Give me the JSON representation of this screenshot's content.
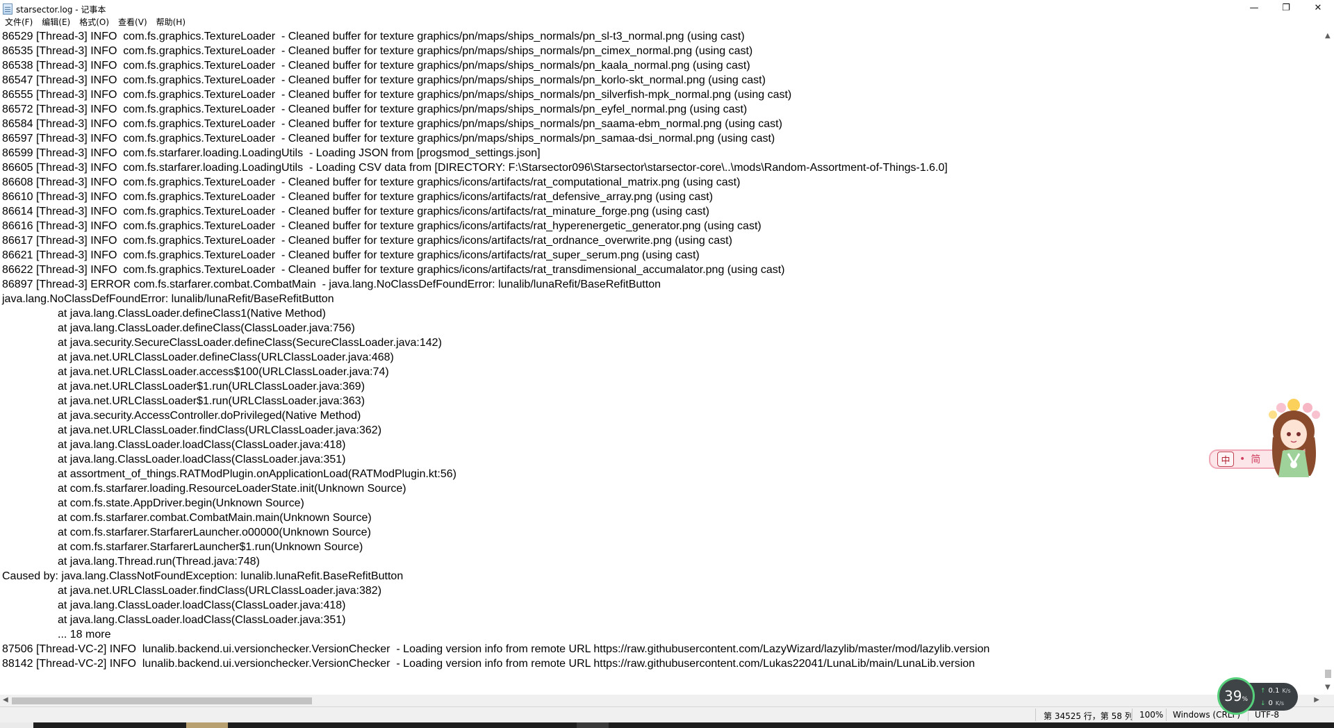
{
  "window": {
    "title": "starsector.log - 记事本",
    "minimize_glyph": "—",
    "maximize_glyph": "❐",
    "close_glyph": "✕",
    "icon": "notepad-icon"
  },
  "menu": [
    "文件(F)",
    "编辑(E)",
    "格式(O)",
    "查看(V)",
    "帮助(H)"
  ],
  "log_lines": [
    {
      "indent": false,
      "text": "86529 [Thread-3] INFO  com.fs.graphics.TextureLoader  - Cleaned buffer for texture graphics/pn/maps/ships_normals/pn_sl-t3_normal.png (using cast)"
    },
    {
      "indent": false,
      "text": "86535 [Thread-3] INFO  com.fs.graphics.TextureLoader  - Cleaned buffer for texture graphics/pn/maps/ships_normals/pn_cimex_normal.png (using cast)"
    },
    {
      "indent": false,
      "text": "86538 [Thread-3] INFO  com.fs.graphics.TextureLoader  - Cleaned buffer for texture graphics/pn/maps/ships_normals/pn_kaala_normal.png (using cast)"
    },
    {
      "indent": false,
      "text": "86547 [Thread-3] INFO  com.fs.graphics.TextureLoader  - Cleaned buffer for texture graphics/pn/maps/ships_normals/pn_korlo-skt_normal.png (using cast)"
    },
    {
      "indent": false,
      "text": "86555 [Thread-3] INFO  com.fs.graphics.TextureLoader  - Cleaned buffer for texture graphics/pn/maps/ships_normals/pn_silverfish-mpk_normal.png (using cast)"
    },
    {
      "indent": false,
      "text": "86572 [Thread-3] INFO  com.fs.graphics.TextureLoader  - Cleaned buffer for texture graphics/pn/maps/ships_normals/pn_eyfel_normal.png (using cast)"
    },
    {
      "indent": false,
      "text": "86584 [Thread-3] INFO  com.fs.graphics.TextureLoader  - Cleaned buffer for texture graphics/pn/maps/ships_normals/pn_saama-ebm_normal.png (using cast)"
    },
    {
      "indent": false,
      "text": "86597 [Thread-3] INFO  com.fs.graphics.TextureLoader  - Cleaned buffer for texture graphics/pn/maps/ships_normals/pn_samaa-dsi_normal.png (using cast)"
    },
    {
      "indent": false,
      "text": "86599 [Thread-3] INFO  com.fs.starfarer.loading.LoadingUtils  - Loading JSON from [progsmod_settings.json]"
    },
    {
      "indent": false,
      "text": "86605 [Thread-3] INFO  com.fs.starfarer.loading.LoadingUtils  - Loading CSV data from [DIRECTORY: F:\\Starsector096\\Starsector\\starsector-core\\..\\mods\\Random-Assortment-of-Things-1.6.0]"
    },
    {
      "indent": false,
      "text": "86608 [Thread-3] INFO  com.fs.graphics.TextureLoader  - Cleaned buffer for texture graphics/icons/artifacts/rat_computational_matrix.png (using cast)"
    },
    {
      "indent": false,
      "text": "86610 [Thread-3] INFO  com.fs.graphics.TextureLoader  - Cleaned buffer for texture graphics/icons/artifacts/rat_defensive_array.png (using cast)"
    },
    {
      "indent": false,
      "text": "86614 [Thread-3] INFO  com.fs.graphics.TextureLoader  - Cleaned buffer for texture graphics/icons/artifacts/rat_minature_forge.png (using cast)"
    },
    {
      "indent": false,
      "text": "86616 [Thread-3] INFO  com.fs.graphics.TextureLoader  - Cleaned buffer for texture graphics/icons/artifacts/rat_hyperenergetic_generator.png (using cast)"
    },
    {
      "indent": false,
      "text": "86617 [Thread-3] INFO  com.fs.graphics.TextureLoader  - Cleaned buffer for texture graphics/icons/artifacts/rat_ordnance_overwrite.png (using cast)"
    },
    {
      "indent": false,
      "text": "86621 [Thread-3] INFO  com.fs.graphics.TextureLoader  - Cleaned buffer for texture graphics/icons/artifacts/rat_super_serum.png (using cast)"
    },
    {
      "indent": false,
      "text": "86622 [Thread-3] INFO  com.fs.graphics.TextureLoader  - Cleaned buffer for texture graphics/icons/artifacts/rat_transdimensional_accumalator.png (using cast)"
    },
    {
      "indent": false,
      "text": "86897 [Thread-3] ERROR com.fs.starfarer.combat.CombatMain  - java.lang.NoClassDefFoundError: lunalib/lunaRefit/BaseRefitButton"
    },
    {
      "indent": false,
      "text": "java.lang.NoClassDefFoundError: lunalib/lunaRefit/BaseRefitButton"
    },
    {
      "indent": true,
      "text": "at java.lang.ClassLoader.defineClass1(Native Method)"
    },
    {
      "indent": true,
      "text": "at java.lang.ClassLoader.defineClass(ClassLoader.java:756)"
    },
    {
      "indent": true,
      "text": "at java.security.SecureClassLoader.defineClass(SecureClassLoader.java:142)"
    },
    {
      "indent": true,
      "text": "at java.net.URLClassLoader.defineClass(URLClassLoader.java:468)"
    },
    {
      "indent": true,
      "text": "at java.net.URLClassLoader.access$100(URLClassLoader.java:74)"
    },
    {
      "indent": true,
      "text": "at java.net.URLClassLoader$1.run(URLClassLoader.java:369)"
    },
    {
      "indent": true,
      "text": "at java.net.URLClassLoader$1.run(URLClassLoader.java:363)"
    },
    {
      "indent": true,
      "text": "at java.security.AccessController.doPrivileged(Native Method)"
    },
    {
      "indent": true,
      "text": "at java.net.URLClassLoader.findClass(URLClassLoader.java:362)"
    },
    {
      "indent": true,
      "text": "at java.lang.ClassLoader.loadClass(ClassLoader.java:418)"
    },
    {
      "indent": true,
      "text": "at java.lang.ClassLoader.loadClass(ClassLoader.java:351)"
    },
    {
      "indent": true,
      "text": "at assortment_of_things.RATModPlugin.onApplicationLoad(RATModPlugin.kt:56)"
    },
    {
      "indent": true,
      "text": "at com.fs.starfarer.loading.ResourceLoaderState.init(Unknown Source)"
    },
    {
      "indent": true,
      "text": "at com.fs.state.AppDriver.begin(Unknown Source)"
    },
    {
      "indent": true,
      "text": "at com.fs.starfarer.combat.CombatMain.main(Unknown Source)"
    },
    {
      "indent": true,
      "text": "at com.fs.starfarer.StarfarerLauncher.o00000(Unknown Source)"
    },
    {
      "indent": true,
      "text": "at com.fs.starfarer.StarfarerLauncher$1.run(Unknown Source)"
    },
    {
      "indent": true,
      "text": "at java.lang.Thread.run(Thread.java:748)"
    },
    {
      "indent": false,
      "text": "Caused by: java.lang.ClassNotFoundException: lunalib.lunaRefit.BaseRefitButton"
    },
    {
      "indent": true,
      "text": "at java.net.URLClassLoader.findClass(URLClassLoader.java:382)"
    },
    {
      "indent": true,
      "text": "at java.lang.ClassLoader.loadClass(ClassLoader.java:418)"
    },
    {
      "indent": true,
      "text": "at java.lang.ClassLoader.loadClass(ClassLoader.java:351)"
    },
    {
      "indent": true,
      "text": "... 18 more"
    },
    {
      "indent": false,
      "text": "87506 [Thread-VC-2] INFO  lunalib.backend.ui.versionchecker.VersionChecker  - Loading version info from remote URL https://raw.githubusercontent.com/LazyWizard/lazylib/master/mod/lazylib.version"
    },
    {
      "indent": false,
      "text": "88142 [Thread-VC-2] INFO  lunalib.backend.ui.versionchecker.VersionChecker  - Loading version info from remote URL https://raw.githubusercontent.com/Lukas22041/LunaLib/main/LunaLib.version"
    }
  ],
  "statusbar": {
    "position": "第 34525 行，第 58 列",
    "zoom": "100%",
    "line_ending": "Windows (CRLF)",
    "encoding": "UTF-8"
  },
  "ime": {
    "mode_char": "中",
    "punct_char": "•",
    "extra_char": "简"
  },
  "net_monitor": {
    "percent": "39",
    "percent_unit": "%",
    "up_speed": "0.1",
    "up_unit": "K/s",
    "down_speed": "0",
    "down_unit": "K/s"
  },
  "colors": {
    "accent_green": "#56d07a",
    "ime_pink": "#f0a8b6"
  }
}
